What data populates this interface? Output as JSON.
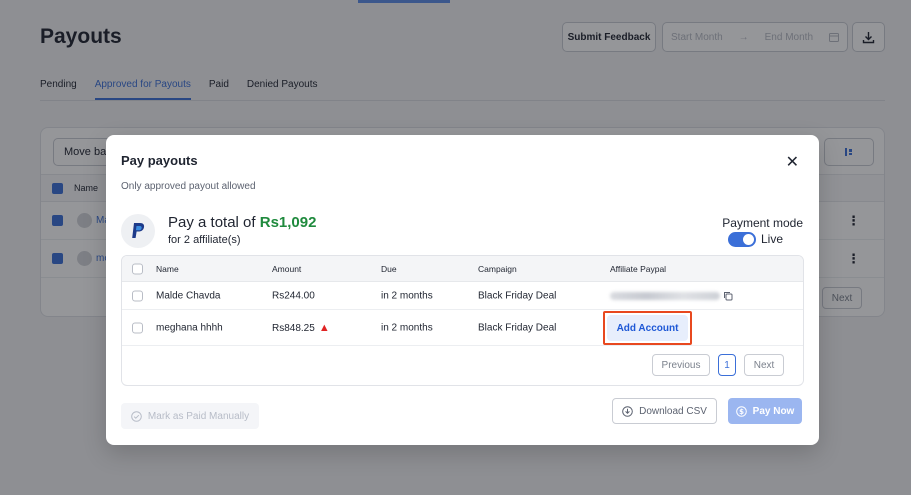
{
  "page": {
    "title": "Payouts",
    "header_buttons": {
      "feedback": "Submit Feedback",
      "start_month": "Start Month",
      "end_month": "End Month"
    },
    "tabs": [
      {
        "label": "Pending",
        "active": false
      },
      {
        "label": "Approved for Payouts",
        "active": true
      },
      {
        "label": "Paid",
        "active": false
      },
      {
        "label": "Denied Payouts",
        "active": false
      }
    ],
    "background_table": {
      "move_button_label": "Move bac",
      "header_name": "Name",
      "rows": [
        {
          "name_fragment": "Ma"
        },
        {
          "name_fragment": "me"
        }
      ],
      "next_label": "Next"
    }
  },
  "modal": {
    "title": "Pay payouts",
    "subtitle": "Only approved payout allowed",
    "total_prefix": "Pay a total of",
    "total_amount": "Rs1,092",
    "affiliate_count": "for 2 affiliate(s)",
    "payment_mode_label": "Payment mode",
    "payment_mode_value": "Live",
    "payment_mode_on": true,
    "table": {
      "columns": [
        "Name",
        "Amount",
        "Due",
        "Campaign",
        "Affiliate Paypal"
      ],
      "rows": [
        {
          "name": "Malde Chavda",
          "amount": "Rs244.00",
          "due": "in 2 months",
          "campaign": "Black Friday Deal",
          "paypal": "email-hidden"
        },
        {
          "name": "meghana hhhh",
          "amount": "Rs848.25",
          "due": "in 2 months",
          "campaign": "Black Friday Deal",
          "paypal_action": "Add Account",
          "warning": true
        }
      ],
      "pagination": {
        "previous": "Previous",
        "current": "1",
        "next": "Next"
      }
    },
    "actions": {
      "mark_paid": "Mark as Paid Manually",
      "download_csv": "Download CSV",
      "pay_now": "Pay Now"
    }
  },
  "colors": {
    "accent": "#3b6fd8",
    "total_green": "#1f8a3d",
    "warning_red": "#e02424",
    "highlight_orange": "#e8481f"
  }
}
